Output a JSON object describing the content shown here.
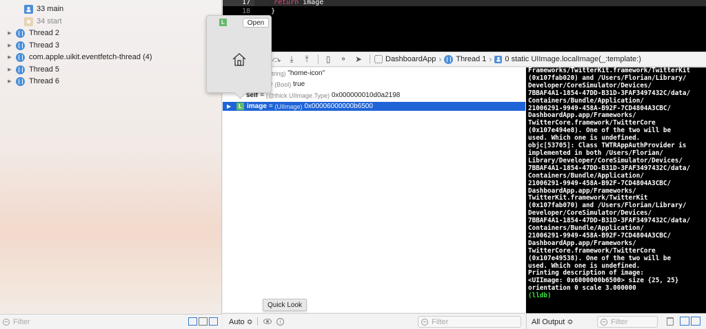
{
  "navigator": {
    "frames": [
      {
        "label": "33 main",
        "icon": "person-frame-icon",
        "dim": false
      },
      {
        "label": "34 start",
        "icon": "library-frame-icon",
        "dim": true
      }
    ],
    "threads": [
      {
        "label": "Thread 2"
      },
      {
        "label": "Thread 3"
      },
      {
        "label": "com.apple.uikit.eventfetch-thread (4)"
      },
      {
        "label": "Thread 5"
      },
      {
        "label": "Thread 6"
      }
    ],
    "filter_placeholder": "Filter"
  },
  "editor": {
    "lines": [
      {
        "number": "17",
        "keyword": "return",
        "text": " image"
      },
      {
        "number": "18",
        "keyword": "",
        "text": "    }"
      }
    ]
  },
  "debug_bar": {
    "breadcrumbs": [
      "DashboardApp",
      "Thread 1",
      "0 static UIImage.localImage(_:template:)"
    ]
  },
  "variables": {
    "rows": [
      {
        "name": "",
        "type": "(String)",
        "value": "\"home-icon\""
      },
      {
        "name": "e",
        "type": "(Bool)",
        "value": "true"
      },
      {
        "name": "self",
        "type": "(@thick UIImage.Type)",
        "value": "0x000000010d0a2198"
      },
      {
        "name": "image",
        "type": "(UIImage)",
        "value": "0x00006000000b6500",
        "badge": "L"
      }
    ],
    "footer": {
      "scope": "Auto ≎",
      "filter_placeholder": "Filter"
    }
  },
  "quicklook": {
    "badge": "L",
    "open_label": "Open",
    "preview_icon": "home-icon"
  },
  "tooltip": "Quick Look",
  "console": {
    "lines": [
      "Frameworks/TwitterKit.framework/TwitterKit",
      "(0x107fab020) and /Users/Florian/Library/",
      "Developer/CoreSimulator/Devices/",
      "7BBAF4A1-1854-47DD-B31D-3FAF3497432C/data/",
      "Containers/Bundle/Application/",
      "21006291-9949-458A-B92F-7CD4804A3CBC/",
      "DashboardApp.app/Frameworks/",
      "TwitterCore.framework/TwitterCore",
      "(0x107e494e8). One of the two will be",
      "used. Which one is undefined.",
      "objc[53705]: Class TWTRAppAuthProvider is",
      "implemented in both /Users/Florian/",
      "Library/Developer/CoreSimulator/Devices/",
      "7BBAF4A1-1854-47DD-B31D-3FAF3497432C/data/",
      "Containers/Bundle/Application/",
      "21006291-9949-458A-B92F-7CD4804A3CBC/",
      "DashboardApp.app/Frameworks/",
      "TwitterKit.framework/TwitterKit",
      "(0x107fab070) and /Users/Florian/Library/",
      "Developer/CoreSimulator/Devices/",
      "7BBAF4A1-1854-47DD-B31D-3FAF3497432C/data/",
      "Containers/Bundle/Application/",
      "21006291-9949-458A-B92F-7CD4804A3CBC/",
      "DashboardApp.app/Frameworks/",
      "TwitterCore.framework/TwitterCore",
      "(0x107e49538). One of the two will be",
      "used. Which one is undefined.",
      "Printing description of image:",
      "<UIImage: 0x6000000b6500> size {25, 25}",
      "orientation 0 scale 3.000000"
    ],
    "prompt": "(lldb)",
    "footer": {
      "output_label": "All Output ≎",
      "filter_placeholder": "Filter"
    }
  },
  "colors": {
    "selection": "#1f64d6",
    "thread_icon": "#4a90d9",
    "badge_green": "#64b96a",
    "keyword": "#e0447c",
    "prompt": "#3ae03a"
  }
}
